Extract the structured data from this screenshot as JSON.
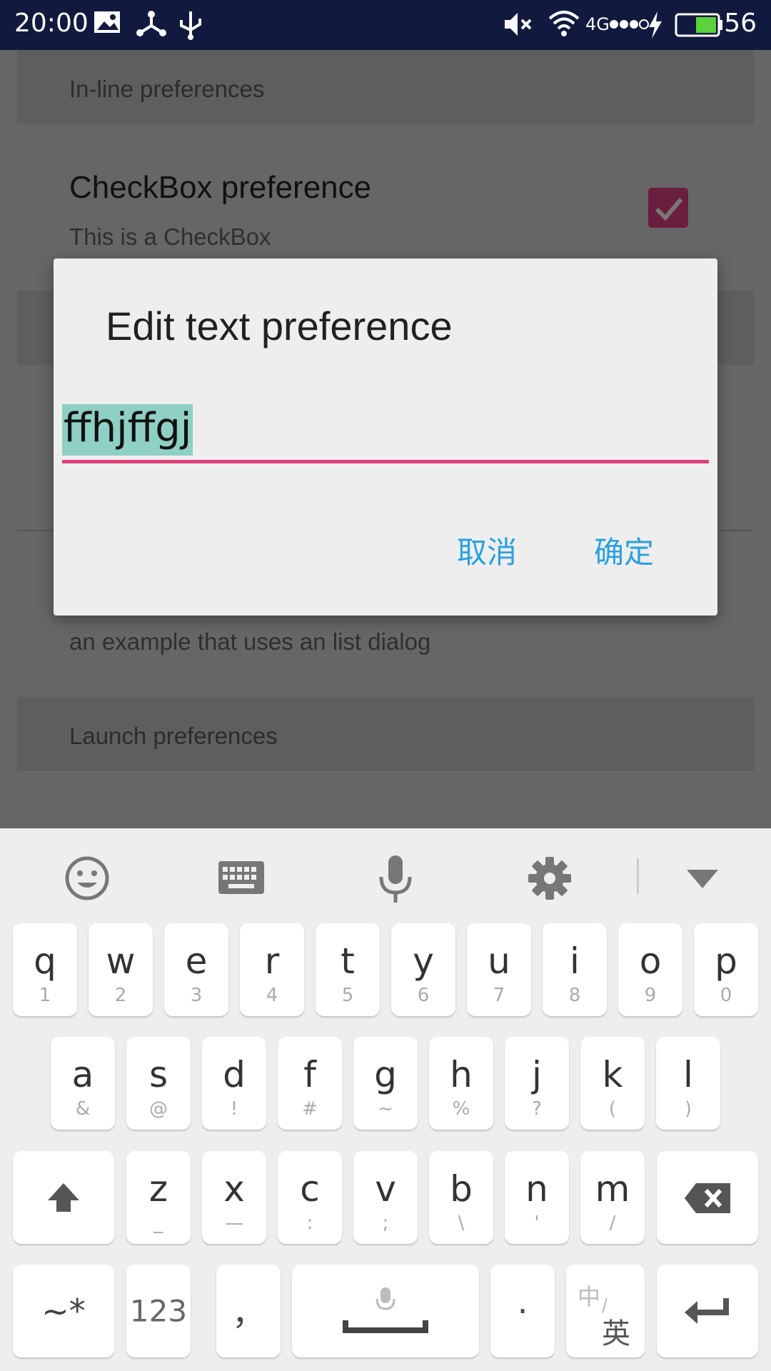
{
  "status_bar": {
    "time": "20:00",
    "network": "4G",
    "battery_level": "56",
    "icons": [
      "image-icon",
      "share-icon",
      "usb-icon",
      "mute-icon",
      "wifi-icon",
      "signal-icon",
      "charging-icon",
      "battery-icon"
    ]
  },
  "background": {
    "category_inline": "In-line preferences",
    "checkbox_title": "CheckBox preference",
    "checkbox_summary": "This is a CheckBox",
    "checkbox_checked": true,
    "list_summary": "an example that uses an list dialog",
    "category_launch": "Launch preferences"
  },
  "dialog": {
    "title": "Edit text preference",
    "input_value": "ffhjffgj",
    "cancel_label": "取消",
    "ok_label": "确定",
    "accent_color": "#2ba1dc",
    "underline_color": "#e2407a"
  },
  "keyboard": {
    "toolbar": [
      "emoji-icon",
      "keyboard-icon",
      "microphone-icon",
      "settings-icon",
      "collapse-icon"
    ],
    "row1": [
      {
        "main": "q",
        "sub": "1"
      },
      {
        "main": "w",
        "sub": "2"
      },
      {
        "main": "e",
        "sub": "3"
      },
      {
        "main": "r",
        "sub": "4"
      },
      {
        "main": "t",
        "sub": "5"
      },
      {
        "main": "y",
        "sub": "6"
      },
      {
        "main": "u",
        "sub": "7"
      },
      {
        "main": "i",
        "sub": "8"
      },
      {
        "main": "o",
        "sub": "9"
      },
      {
        "main": "p",
        "sub": "0"
      }
    ],
    "row2": [
      {
        "main": "a",
        "sub": "&"
      },
      {
        "main": "s",
        "sub": "@"
      },
      {
        "main": "d",
        "sub": "!"
      },
      {
        "main": "f",
        "sub": "#"
      },
      {
        "main": "g",
        "sub": "~"
      },
      {
        "main": "h",
        "sub": "%"
      },
      {
        "main": "j",
        "sub": "?"
      },
      {
        "main": "k",
        "sub": "("
      },
      {
        "main": "l",
        "sub": ")"
      }
    ],
    "row3": [
      {
        "main": "z",
        "sub": "_"
      },
      {
        "main": "x",
        "sub": "—"
      },
      {
        "main": "c",
        "sub": ":"
      },
      {
        "main": "v",
        "sub": ";"
      },
      {
        "main": "b",
        "sub": "\\"
      },
      {
        "main": "n",
        "sub": "'"
      },
      {
        "main": "m",
        "sub": "/"
      }
    ],
    "symbols_label": "~*",
    "numbers_label": "123",
    "comma_label": "，",
    "period_label": "·",
    "lang_zh": "中",
    "lang_en": "英"
  }
}
